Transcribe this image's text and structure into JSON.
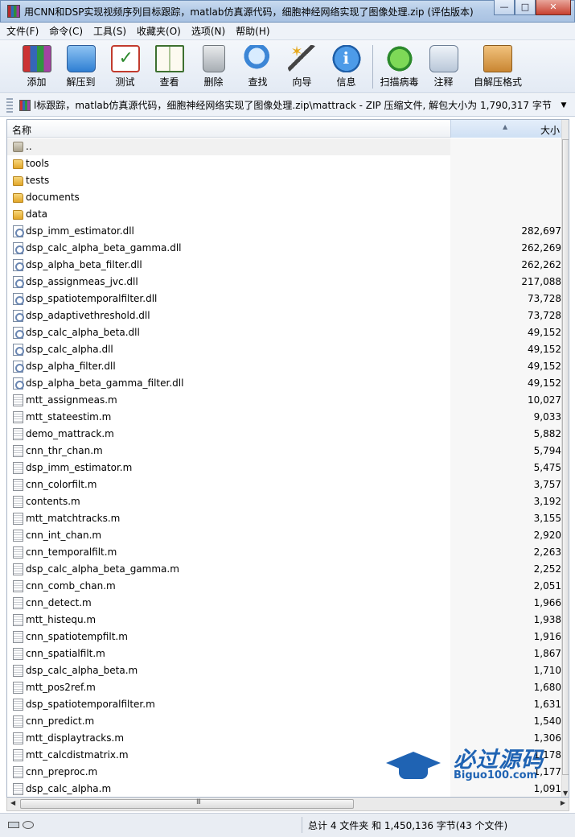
{
  "window": {
    "title": "用CNN和DSP实现视频序列目标跟踪，matlab仿真源代码，细胞神经网络实现了图像处理.zip (评估版本)",
    "minimize_label": "—",
    "maximize_label": "□",
    "close_label": "✕"
  },
  "menu": [
    "文件(F)",
    "命令(C)",
    "工具(S)",
    "收藏夹(O)",
    "选项(N)",
    "帮助(H)"
  ],
  "toolbar": {
    "buttons": [
      {
        "label": "添加",
        "icon": "add-icon"
      },
      {
        "label": "解压到",
        "icon": "extract-icon"
      },
      {
        "label": "测试",
        "icon": "test-icon"
      },
      {
        "label": "查看",
        "icon": "view-icon"
      },
      {
        "label": "删除",
        "icon": "delete-icon"
      },
      {
        "label": "查找",
        "icon": "find-icon"
      },
      {
        "label": "向导",
        "icon": "wizard-icon"
      },
      {
        "label": "信息",
        "icon": "info-icon"
      },
      {
        "label": "扫描病毒",
        "icon": "virus-scan-icon"
      },
      {
        "label": "注释",
        "icon": "comment-icon"
      },
      {
        "label": "自解压格式",
        "icon": "sfx-icon"
      }
    ]
  },
  "address": {
    "path": "l标跟踪，matlab仿真源代码，细胞神经网络实现了图像处理.zip\\mattrack - ZIP 压缩文件, 解包大小为 1,790,317 字节",
    "dropdown_label": "▼"
  },
  "columns": {
    "name": "名称",
    "size": "大小"
  },
  "files": [
    {
      "name": "..",
      "size": "",
      "type": "up"
    },
    {
      "name": "tools",
      "size": "",
      "type": "folder"
    },
    {
      "name": "tests",
      "size": "",
      "type": "folder"
    },
    {
      "name": "documents",
      "size": "",
      "type": "folder"
    },
    {
      "name": "data",
      "size": "",
      "type": "folder"
    },
    {
      "name": "dsp_imm_estimator.dll",
      "size": "282,697",
      "type": "dll"
    },
    {
      "name": "dsp_calc_alpha_beta_gamma.dll",
      "size": "262,269",
      "type": "dll"
    },
    {
      "name": "dsp_alpha_beta_filter.dll",
      "size": "262,262",
      "type": "dll"
    },
    {
      "name": "dsp_assignmeas_jvc.dll",
      "size": "217,088",
      "type": "dll"
    },
    {
      "name": "dsp_spatiotemporalfilter.dll",
      "size": "73,728",
      "type": "dll"
    },
    {
      "name": "dsp_adaptivethreshold.dll",
      "size": "73,728",
      "type": "dll"
    },
    {
      "name": "dsp_calc_alpha_beta.dll",
      "size": "49,152",
      "type": "dll"
    },
    {
      "name": "dsp_calc_alpha.dll",
      "size": "49,152",
      "type": "dll"
    },
    {
      "name": "dsp_alpha_filter.dll",
      "size": "49,152",
      "type": "dll"
    },
    {
      "name": "dsp_alpha_beta_gamma_filter.dll",
      "size": "49,152",
      "type": "dll"
    },
    {
      "name": "mtt_assignmeas.m",
      "size": "10,027",
      "type": "m"
    },
    {
      "name": "mtt_stateestim.m",
      "size": "9,033",
      "type": "m"
    },
    {
      "name": "demo_mattrack.m",
      "size": "5,882",
      "type": "m"
    },
    {
      "name": "cnn_thr_chan.m",
      "size": "5,794",
      "type": "m"
    },
    {
      "name": "dsp_imm_estimator.m",
      "size": "5,475",
      "type": "m"
    },
    {
      "name": "cnn_colorfilt.m",
      "size": "3,757",
      "type": "m"
    },
    {
      "name": "contents.m",
      "size": "3,192",
      "type": "m"
    },
    {
      "name": "mtt_matchtracks.m",
      "size": "3,155",
      "type": "m"
    },
    {
      "name": "cnn_int_chan.m",
      "size": "2,920",
      "type": "m"
    },
    {
      "name": "cnn_temporalfilt.m",
      "size": "2,263",
      "type": "m"
    },
    {
      "name": "dsp_calc_alpha_beta_gamma.m",
      "size": "2,252",
      "type": "m"
    },
    {
      "name": "cnn_comb_chan.m",
      "size": "2,051",
      "type": "m"
    },
    {
      "name": "cnn_detect.m",
      "size": "1,966",
      "type": "m"
    },
    {
      "name": "mtt_histequ.m",
      "size": "1,938",
      "type": "m"
    },
    {
      "name": "cnn_spatiotempfilt.m",
      "size": "1,916",
      "type": "m"
    },
    {
      "name": "cnn_spatialfilt.m",
      "size": "1,867",
      "type": "m"
    },
    {
      "name": "dsp_calc_alpha_beta.m",
      "size": "1,710",
      "type": "m"
    },
    {
      "name": "mtt_pos2ref.m",
      "size": "1,680",
      "type": "m"
    },
    {
      "name": "dsp_spatiotemporalfilter.m",
      "size": "1,631",
      "type": "m"
    },
    {
      "name": "cnn_predict.m",
      "size": "1,540",
      "type": "m"
    },
    {
      "name": "mtt_displaytracks.m",
      "size": "1,306",
      "type": "m"
    },
    {
      "name": "mtt_calcdistmatrix.m",
      "size": "1,178",
      "type": "m"
    },
    {
      "name": "cnn_preproc.m",
      "size": "1,177",
      "type": "m"
    },
    {
      "name": "dsp_calc_alpha.m",
      "size": "1,091",
      "type": "m"
    }
  ],
  "scrollbar": {
    "grip": "III",
    "left_arrow": "◀",
    "right_arrow": "▶",
    "down_arrow": "▼",
    "sort_arrow": "▲"
  },
  "status": {
    "summary": "总计 4 文件夹 和 1,450,136 字节(43 个文件)"
  },
  "watermark": {
    "title": "必过源码",
    "subtitle": "Biguo100.com",
    "color": "#1f63b3"
  }
}
